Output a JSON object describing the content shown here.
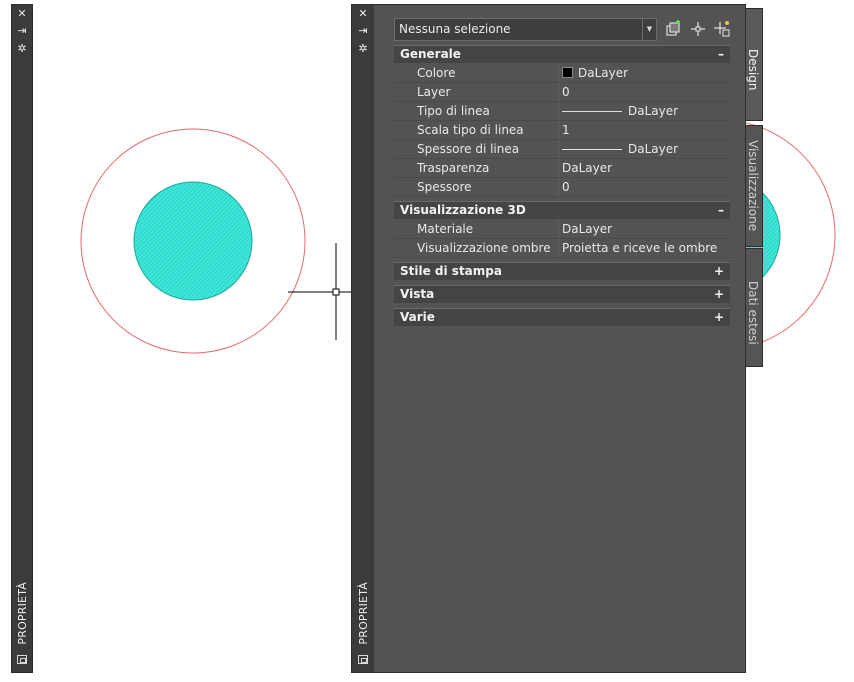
{
  "palette": {
    "title": "PROPRIETÀ",
    "selector": {
      "value": "Nessuna selezione"
    },
    "sections": [
      {
        "title": "Generale",
        "toggle": "–",
        "expanded": true,
        "rows": [
          {
            "name": "Colore",
            "value": "DaLayer",
            "swatch": "#000000"
          },
          {
            "name": "Layer",
            "value": "0"
          },
          {
            "name": "Tipo di linea",
            "value": "DaLayer",
            "line": true
          },
          {
            "name": "Scala tipo di linea",
            "value": "1"
          },
          {
            "name": "Spessore di linea",
            "value": "DaLayer",
            "line": true
          },
          {
            "name": "Trasparenza",
            "value": "DaLayer"
          },
          {
            "name": "Spessore",
            "value": "0"
          }
        ]
      },
      {
        "title": "Visualizzazione 3D",
        "toggle": "–",
        "expanded": true,
        "rows": [
          {
            "name": "Materiale",
            "value": "DaLayer"
          },
          {
            "name": "Visualizzazione ombre",
            "value": "Proietta e riceve le ombre"
          }
        ]
      },
      {
        "title": "Stile di stampa",
        "toggle": "+",
        "expanded": false,
        "rows": []
      },
      {
        "title": "Vista",
        "toggle": "+",
        "expanded": false,
        "rows": []
      },
      {
        "title": "Varie",
        "toggle": "+",
        "expanded": false,
        "rows": []
      }
    ],
    "tabs": [
      {
        "label": "Design"
      },
      {
        "label": "Visualizzazione"
      },
      {
        "label": "Dati estesi"
      }
    ]
  },
  "left_palette": {
    "title": "PROPRIETÀ"
  },
  "colors": {
    "circle_outline": "#e46a6a",
    "hatch_fill": "#2ee0d2",
    "panel": "#535353"
  },
  "icons": {
    "close": "close-icon",
    "autohide": "autohide-icon",
    "settings": "gear-icon",
    "quickselect": "quick-select-icon",
    "selectobjects": "select-objects-icon",
    "pickadd": "pickadd-toggle-icon",
    "palettemenu": "palette-menu-icon"
  }
}
